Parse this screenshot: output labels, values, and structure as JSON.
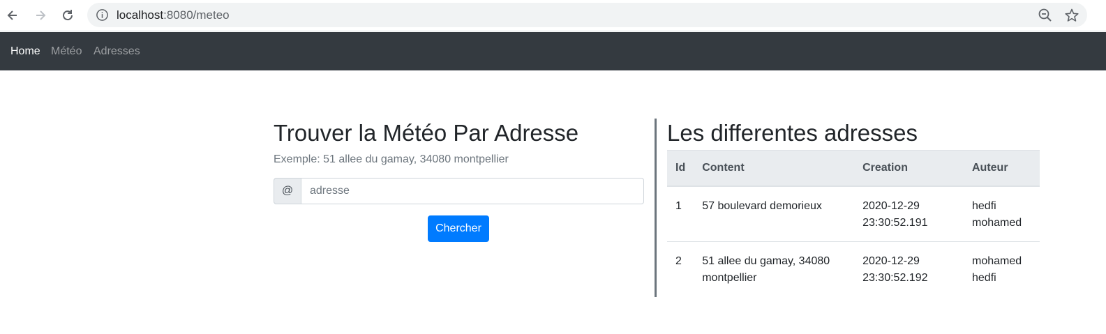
{
  "browser": {
    "url_host": "localhost",
    "url_path": ":8080/meteo",
    "icons": [
      "back-icon",
      "forward-icon",
      "reload-icon",
      "info-icon",
      "zoom-icon",
      "star-icon"
    ]
  },
  "navbar": {
    "items": [
      {
        "label": "Home",
        "active": true
      },
      {
        "label": "Météo",
        "active": false
      },
      {
        "label": "Adresses",
        "active": false
      }
    ]
  },
  "search": {
    "title": "Trouver la Météo Par Adresse",
    "example": "Exemple: 51 allee du gamay, 34080 montpellier",
    "prepend": "@",
    "placeholder": "adresse",
    "button_label": "Chercher"
  },
  "addresses": {
    "title": "Les differentes adresses",
    "columns": [
      "Id",
      "Content",
      "Creation",
      "Auteur"
    ],
    "rows": [
      {
        "id": "1",
        "content": "57 boulevard demorieux",
        "creation": "2020-12-29 23:30:52.191",
        "auteur": "hedfi mohamed"
      },
      {
        "id": "2",
        "content": "51 allee du gamay, 34080 montpellier",
        "creation": "2020-12-29 23:30:52.192",
        "auteur": "mohamed hedfi"
      }
    ]
  },
  "colors": {
    "navbar_bg": "#343a40",
    "primary": "#007bff",
    "muted": "#6c757d",
    "table_head_bg": "#e9ecef"
  }
}
